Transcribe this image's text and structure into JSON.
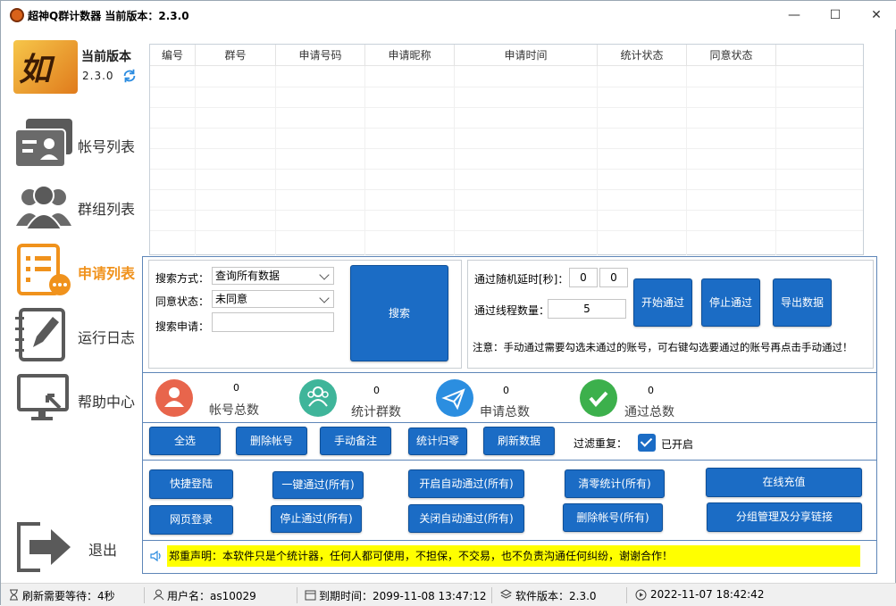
{
  "window": {
    "title": "超神Q群计数器 当前版本：2.3.0",
    "minimize": "—",
    "maximize": "☐",
    "close": "✕"
  },
  "sidebar": {
    "version_title": "当前版本",
    "version_number": "2.3.0",
    "items": [
      {
        "label": "帐号列表",
        "icon": "account-card-icon"
      },
      {
        "label": "群组列表",
        "icon": "users-group-icon"
      },
      {
        "label": "申请列表",
        "icon": "request-list-icon",
        "active": true
      },
      {
        "label": "运行日志",
        "icon": "notebook-pen-icon"
      },
      {
        "label": "帮助中心",
        "icon": "monitor-help-icon"
      }
    ],
    "exit_label": "退出"
  },
  "table": {
    "columns": [
      "编号",
      "群号",
      "申请号码",
      "申请昵称",
      "申请时间",
      "统计状态",
      "同意状态"
    ],
    "rows": []
  },
  "search": {
    "method_label": "搜索方式：",
    "method_value": "查询所有数据",
    "agree_label": "同意状态：",
    "agree_value": "未同意",
    "keyword_label": "搜索申请：",
    "keyword_value": "",
    "search_button": "搜索"
  },
  "pass": {
    "delay_label": "通过随机延时[秒]：",
    "delay_min": "0",
    "delay_max": "0",
    "threads_label": "通过线程数量：",
    "threads_value": "5",
    "start_button": "开始通过",
    "stop_button": "停止通过",
    "export_button": "导出数据",
    "note": "注意：手动通过需要勾选未通过的账号，可右键勾选要通过的账号再点击手动通过！"
  },
  "stats": [
    {
      "label": "帐号总数",
      "value": "0",
      "color": "#e8654c",
      "icon": "person-icon"
    },
    {
      "label": "统计群数",
      "value": "0",
      "color": "#3fb59a",
      "icon": "group-icon"
    },
    {
      "label": "申请总数",
      "value": "0",
      "color": "#2b8ee0",
      "icon": "paper-plane-icon"
    },
    {
      "label": "通过总数",
      "value": "0",
      "color": "#3cb04c",
      "icon": "checkmark-icon"
    }
  ],
  "actions": {
    "select_all": "全选",
    "delete_account": "删除帐号",
    "manual_note": "手动备注",
    "stat_reset": "统计归零",
    "refresh_data": "刷新数据",
    "filter_label": "过滤重复：",
    "filter_state": "已开启"
  },
  "bottom_buttons": {
    "quick_login": "快捷登陆",
    "web_login": "网页登录",
    "one_key_pass": "一键通过(所有)",
    "stop_pass_all": "停止通过(所有)",
    "auto_pass_on": "开启自动通过(所有)",
    "auto_pass_off": "关闭自动通过(所有)",
    "clear_stats": "清零统计(所有)",
    "delete_all": "删除帐号(所有)",
    "recharge": "在线充值",
    "group_manage": "分组管理及分享链接"
  },
  "notice": "郑重声明：本软件只是个统计器，任何人都可使用，不担保，不交易，也不负责沟通任何纠纷，谢谢合作！",
  "statusbar": {
    "refresh_wait": "刷新需要等待：4秒",
    "user": "用户名：as10029",
    "expire": "到期时间：2099-11-08 13:47:12",
    "software_version": "软件版本：2.3.0",
    "clock": "2022-11-07 18:42:42"
  },
  "colors": {
    "accent_blue": "#1b6cc5",
    "active_orange": "#f0921c",
    "notice_yellow": "#ffff00"
  }
}
